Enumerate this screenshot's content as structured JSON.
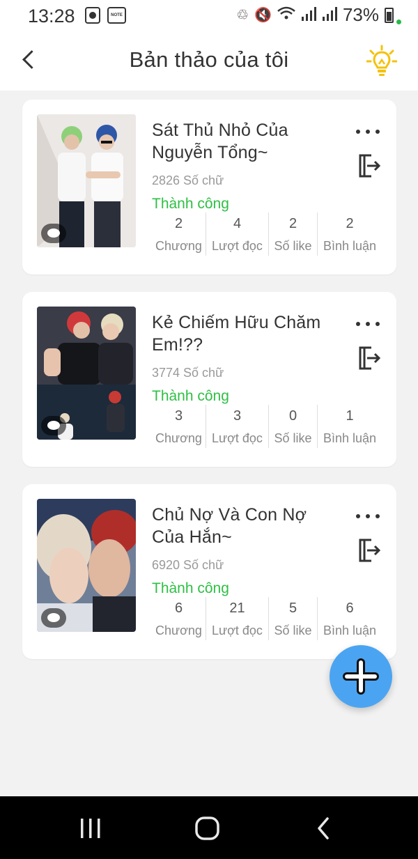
{
  "status_bar": {
    "time": "13:28",
    "note_label": "NOTE",
    "battery": "73%"
  },
  "header": {
    "title": "Bản thảo của tôi",
    "icons": {
      "back": "back-arrow-icon",
      "tip": "lightbulb-icon"
    }
  },
  "colors": {
    "success": "#2ebf44",
    "fab": "#4ba4f2",
    "bulb": "#f4c20d"
  },
  "drafts": [
    {
      "title": "Sát Thủ Nhỏ Của Nguyễn Tổng~",
      "word_count": "2826 Số chữ",
      "status": "Thành công",
      "stats": [
        {
          "value": "2",
          "label": "Chương"
        },
        {
          "value": "4",
          "label": "Lượt đọc"
        },
        {
          "value": "2",
          "label": "Số like"
        },
        {
          "value": "2",
          "label": "Bình luận"
        }
      ]
    },
    {
      "title": "Kẻ Chiếm Hữu Chăm Em!??",
      "word_count": "3774 Số chữ",
      "status": "Thành công",
      "stats": [
        {
          "value": "3",
          "label": "Chương"
        },
        {
          "value": "3",
          "label": "Lượt đọc"
        },
        {
          "value": "0",
          "label": "Số like"
        },
        {
          "value": "1",
          "label": "Bình luận"
        }
      ]
    },
    {
      "title": "Chủ Nợ Và Con Nợ Của Hắn~",
      "word_count": "6920 Số chữ",
      "status": "Thành công",
      "stats": [
        {
          "value": "6",
          "label": "Chương"
        },
        {
          "value": "21",
          "label": "Lượt đọc"
        },
        {
          "value": "5",
          "label": "Số like"
        },
        {
          "value": "6",
          "label": "Bình luận"
        }
      ]
    }
  ]
}
